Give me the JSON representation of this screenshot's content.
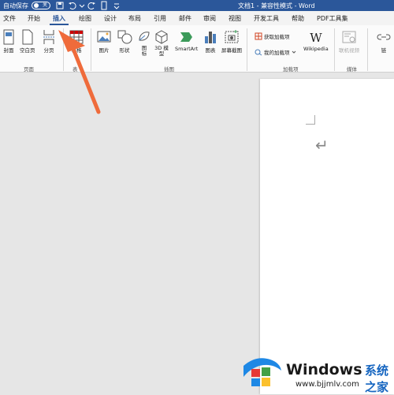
{
  "titlebar": {
    "autosave_label": "自动保存",
    "autosave_state": "关",
    "doc_title": "文档1 - 兼容性模式 - Word"
  },
  "tabs": [
    {
      "label": "文件"
    },
    {
      "label": "开始"
    },
    {
      "label": "插入"
    },
    {
      "label": "绘图"
    },
    {
      "label": "设计"
    },
    {
      "label": "布局"
    },
    {
      "label": "引用"
    },
    {
      "label": "邮件"
    },
    {
      "label": "审阅"
    },
    {
      "label": "视图"
    },
    {
      "label": "开发工具"
    },
    {
      "label": "帮助"
    },
    {
      "label": "PDF工具集"
    }
  ],
  "active_tab": "插入",
  "ribbon": {
    "pages": {
      "cover": "封面",
      "blank": "空白页",
      "break": "分页",
      "group": "页面"
    },
    "tables": {
      "table": "表格",
      "group": "表"
    },
    "illustrations": {
      "pictures": "图片",
      "shapes": "形状",
      "icons_top": "图",
      "icons_bottom": "标",
      "models_top": "3D 模",
      "models_bottom": "型",
      "smartart": "SmartArt",
      "chart": "图表",
      "screenshot": "屏幕截图",
      "group": "插图"
    },
    "addins": {
      "get": "获取加载项",
      "my": "我的加载项",
      "wikipedia": "Wikipedia",
      "group": "加载项"
    },
    "media": {
      "video": "联机视频",
      "group": "媒体"
    },
    "links": {
      "link": "链"
    }
  },
  "watermark": {
    "brand": "Windows",
    "cn": "系统之家",
    "url": "www.bjjmlv.com"
  },
  "colors": {
    "titlebar": "#2b579a",
    "arrow": "#ef6b3b",
    "watermark_blue": "#1565c0"
  }
}
